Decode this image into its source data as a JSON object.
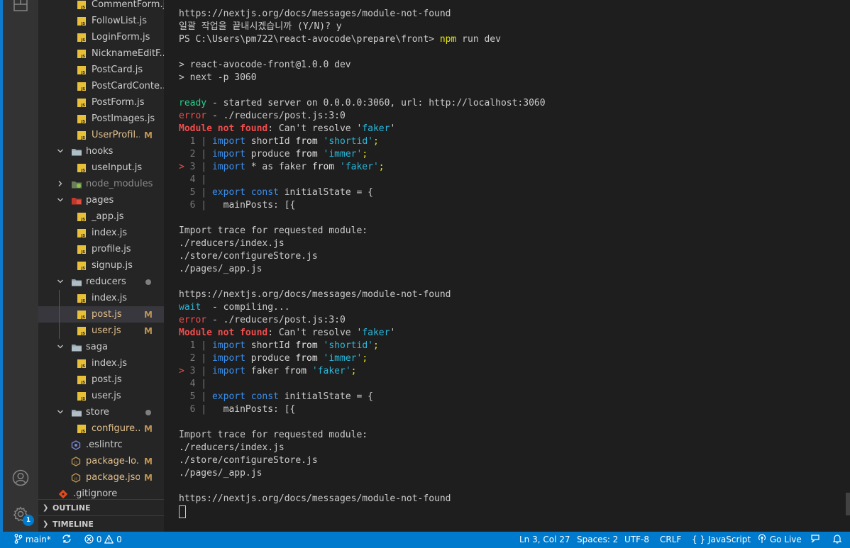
{
  "explorer": {
    "items": [
      {
        "name": "CommentForm.js",
        "type": "js",
        "depth": 3,
        "badge": ""
      },
      {
        "name": "FollowList.js",
        "type": "js",
        "depth": 3,
        "badge": ""
      },
      {
        "name": "LoginForm.js",
        "type": "js",
        "depth": 3,
        "badge": ""
      },
      {
        "name": "NicknameEditF...",
        "type": "js",
        "depth": 3,
        "badge": ""
      },
      {
        "name": "PostCard.js",
        "type": "js",
        "depth": 3,
        "badge": ""
      },
      {
        "name": "PostCardConte...",
        "type": "js",
        "depth": 3,
        "badge": ""
      },
      {
        "name": "PostForm.js",
        "type": "js",
        "depth": 3,
        "badge": ""
      },
      {
        "name": "PostImages.js",
        "type": "js",
        "depth": 3,
        "badge": ""
      },
      {
        "name": "UserProfil...",
        "type": "js",
        "depth": 3,
        "badge": "M",
        "modified": true
      },
      {
        "name": "hooks",
        "type": "folder",
        "depth": 2,
        "expanded": true,
        "badge": ""
      },
      {
        "name": "useInput.js",
        "type": "js",
        "depth": 3,
        "badge": ""
      },
      {
        "name": "node_modules",
        "type": "folder-node",
        "depth": 2,
        "expanded": false,
        "badge": "",
        "dim": true
      },
      {
        "name": "pages",
        "type": "folder-pages",
        "depth": 2,
        "expanded": true,
        "badge": ""
      },
      {
        "name": "_app.js",
        "type": "js",
        "depth": 3,
        "badge": ""
      },
      {
        "name": "index.js",
        "type": "js",
        "depth": 3,
        "badge": ""
      },
      {
        "name": "profile.js",
        "type": "js",
        "depth": 3,
        "badge": ""
      },
      {
        "name": "signup.js",
        "type": "js",
        "depth": 3,
        "badge": ""
      },
      {
        "name": "reducers",
        "type": "folder",
        "depth": 2,
        "expanded": true,
        "badge": "",
        "dot": true,
        "modified": true
      },
      {
        "name": "index.js",
        "type": "js",
        "depth": 3,
        "badge": ""
      },
      {
        "name": "post.js",
        "type": "js",
        "depth": 3,
        "badge": "M",
        "modified": true,
        "selected": true
      },
      {
        "name": "user.js",
        "type": "js",
        "depth": 3,
        "badge": "M",
        "modified": true
      },
      {
        "name": "saga",
        "type": "folder",
        "depth": 2,
        "expanded": true,
        "badge": ""
      },
      {
        "name": "index.js",
        "type": "js",
        "depth": 3,
        "badge": ""
      },
      {
        "name": "post.js",
        "type": "js",
        "depth": 3,
        "badge": ""
      },
      {
        "name": "user.js",
        "type": "js",
        "depth": 3,
        "badge": ""
      },
      {
        "name": "store",
        "type": "folder",
        "depth": 2,
        "expanded": true,
        "badge": "",
        "dot": true,
        "modified": true
      },
      {
        "name": "configure...",
        "type": "js",
        "depth": 3,
        "badge": "M",
        "modified": true
      },
      {
        "name": ".eslintrc",
        "type": "eslint",
        "depth": 2,
        "badge": ""
      },
      {
        "name": "package-lo...",
        "type": "json",
        "depth": 2,
        "badge": "M",
        "modified": true
      },
      {
        "name": "package.json",
        "type": "json",
        "depth": 2,
        "badge": "M",
        "modified": true
      },
      {
        "name": ".gitignore",
        "type": "git",
        "depth": 1,
        "badge": ""
      }
    ],
    "sections": [
      {
        "label": "OUTLINE"
      },
      {
        "label": "TIMELINE"
      }
    ]
  },
  "activity": {
    "top_icon": "explorer-icon",
    "account_icon": "account-icon",
    "settings_icon": "gear-icon",
    "settings_badge": "1"
  },
  "terminal": {
    "lines": [
      [
        {
          "t": "https://nextjs.org/docs/messages/module-not-found"
        }
      ],
      [
        {
          "t": "일괄 작업을 끝내시겠습니까 (Y/N)? y"
        }
      ],
      [
        {
          "t": "PS C:\\Users\\pm722\\react-avocode\\prepare\\front> "
        },
        {
          "t": "npm",
          "c": "y"
        },
        {
          "t": " run dev"
        }
      ],
      [],
      [
        {
          "t": "> react-avocode-front@1.0.0 dev"
        }
      ],
      [
        {
          "t": "> next -p 3060"
        }
      ],
      [],
      [
        {
          "t": "ready",
          "c": "g"
        },
        {
          "t": " - started server on 0.0.0.0:3060, url: http://localhost:3060"
        }
      ],
      [
        {
          "t": "error",
          "c": "r"
        },
        {
          "t": " - ./reducers/post.js:3:0"
        }
      ],
      [
        {
          "t": "Module not found",
          "c": "rb"
        },
        {
          "t": ": Can't resolve '"
        },
        {
          "t": "faker",
          "c": "c"
        },
        {
          "t": "'"
        }
      ],
      [
        {
          "t": "  "
        },
        {
          "t": "1",
          "c": "gr"
        },
        {
          "t": " | ",
          "c": "gr"
        },
        {
          "t": "import",
          "c": "b"
        },
        {
          "t": " shortId "
        },
        {
          "t": "from",
          "c": "w"
        },
        {
          "t": " "
        },
        {
          "t": "'shortid'",
          "c": "c"
        },
        {
          "t": ";",
          "c": "y"
        }
      ],
      [
        {
          "t": "  "
        },
        {
          "t": "2",
          "c": "gr"
        },
        {
          "t": " | ",
          "c": "gr"
        },
        {
          "t": "import",
          "c": "b"
        },
        {
          "t": " produce "
        },
        {
          "t": "from",
          "c": "w"
        },
        {
          "t": " "
        },
        {
          "t": "'immer'",
          "c": "c"
        },
        {
          "t": ";",
          "c": "y"
        }
      ],
      [
        {
          "t": "> ",
          "c": "r"
        },
        {
          "t": "3",
          "c": "gr"
        },
        {
          "t": " | ",
          "c": "gr"
        },
        {
          "t": "import",
          "c": "b"
        },
        {
          "t": " * as faker "
        },
        {
          "t": "from",
          "c": "w"
        },
        {
          "t": " "
        },
        {
          "t": "'faker'",
          "c": "c"
        },
        {
          "t": ";",
          "c": "y"
        }
      ],
      [
        {
          "t": "  "
        },
        {
          "t": "4",
          "c": "gr"
        },
        {
          "t": " |",
          "c": "gr"
        }
      ],
      [
        {
          "t": "  "
        },
        {
          "t": "5",
          "c": "gr"
        },
        {
          "t": " | ",
          "c": "gr"
        },
        {
          "t": "export",
          "c": "b"
        },
        {
          "t": " "
        },
        {
          "t": "const",
          "c": "b"
        },
        {
          "t": " initialState = {"
        }
      ],
      [
        {
          "t": "  "
        },
        {
          "t": "6",
          "c": "gr"
        },
        {
          "t": " | ",
          "c": "gr"
        },
        {
          "t": "  mainPosts: [{"
        }
      ],
      [],
      [
        {
          "t": "Import trace for requested module:"
        }
      ],
      [
        {
          "t": "./reducers/index.js"
        }
      ],
      [
        {
          "t": "./store/configureStore.js"
        }
      ],
      [
        {
          "t": "./pages/_app.js"
        }
      ],
      [],
      [
        {
          "t": "https://nextjs.org/docs/messages/module-not-found"
        }
      ],
      [
        {
          "t": "wait",
          "c": "c"
        },
        {
          "t": "  - compiling..."
        }
      ],
      [
        {
          "t": "error",
          "c": "r"
        },
        {
          "t": " - ./reducers/post.js:3:0"
        }
      ],
      [
        {
          "t": "Module not found",
          "c": "rb"
        },
        {
          "t": ": Can't resolve '"
        },
        {
          "t": "faker",
          "c": "c"
        },
        {
          "t": "'"
        }
      ],
      [
        {
          "t": "  "
        },
        {
          "t": "1",
          "c": "gr"
        },
        {
          "t": " | ",
          "c": "gr"
        },
        {
          "t": "import",
          "c": "b"
        },
        {
          "t": " shortId "
        },
        {
          "t": "from",
          "c": "w"
        },
        {
          "t": " "
        },
        {
          "t": "'shortid'",
          "c": "c"
        },
        {
          "t": ";",
          "c": "y"
        }
      ],
      [
        {
          "t": "  "
        },
        {
          "t": "2",
          "c": "gr"
        },
        {
          "t": " | ",
          "c": "gr"
        },
        {
          "t": "import",
          "c": "b"
        },
        {
          "t": " produce "
        },
        {
          "t": "from",
          "c": "w"
        },
        {
          "t": " "
        },
        {
          "t": "'immer'",
          "c": "c"
        },
        {
          "t": ";",
          "c": "y"
        }
      ],
      [
        {
          "t": "> ",
          "c": "r"
        },
        {
          "t": "3",
          "c": "gr"
        },
        {
          "t": " | ",
          "c": "gr"
        },
        {
          "t": "import",
          "c": "b"
        },
        {
          "t": " faker "
        },
        {
          "t": "from",
          "c": "w"
        },
        {
          "t": " "
        },
        {
          "t": "'faker'",
          "c": "c"
        },
        {
          "t": ";",
          "c": "y"
        }
      ],
      [
        {
          "t": "  "
        },
        {
          "t": "4",
          "c": "gr"
        },
        {
          "t": " |",
          "c": "gr"
        }
      ],
      [
        {
          "t": "  "
        },
        {
          "t": "5",
          "c": "gr"
        },
        {
          "t": " | ",
          "c": "gr"
        },
        {
          "t": "export",
          "c": "b"
        },
        {
          "t": " "
        },
        {
          "t": "const",
          "c": "b"
        },
        {
          "t": " initialState = {"
        }
      ],
      [
        {
          "t": "  "
        },
        {
          "t": "6",
          "c": "gr"
        },
        {
          "t": " | ",
          "c": "gr"
        },
        {
          "t": "  mainPosts: [{"
        }
      ],
      [],
      [
        {
          "t": "Import trace for requested module:"
        }
      ],
      [
        {
          "t": "./reducers/index.js"
        }
      ],
      [
        {
          "t": "./store/configureStore.js"
        }
      ],
      [
        {
          "t": "./pages/_app.js"
        }
      ],
      [],
      [
        {
          "t": "https://nextjs.org/docs/messages/module-not-found"
        }
      ],
      [
        {
          "t": "",
          "cursor": true
        }
      ]
    ]
  },
  "statusbar": {
    "branch": "main*",
    "errors": "0",
    "warnings": "0",
    "position": "Ln 3, Col 27",
    "spaces": "Spaces: 2",
    "encoding": "UTF-8",
    "eol": "CRLF",
    "language": "JavaScript",
    "golive": "Go Live"
  },
  "colors": {
    "statusbar": "#007acc",
    "sidebar": "#252526",
    "activitybar": "#333333",
    "modified": "#c09553",
    "terminal_bg": "#1e1e1e"
  }
}
